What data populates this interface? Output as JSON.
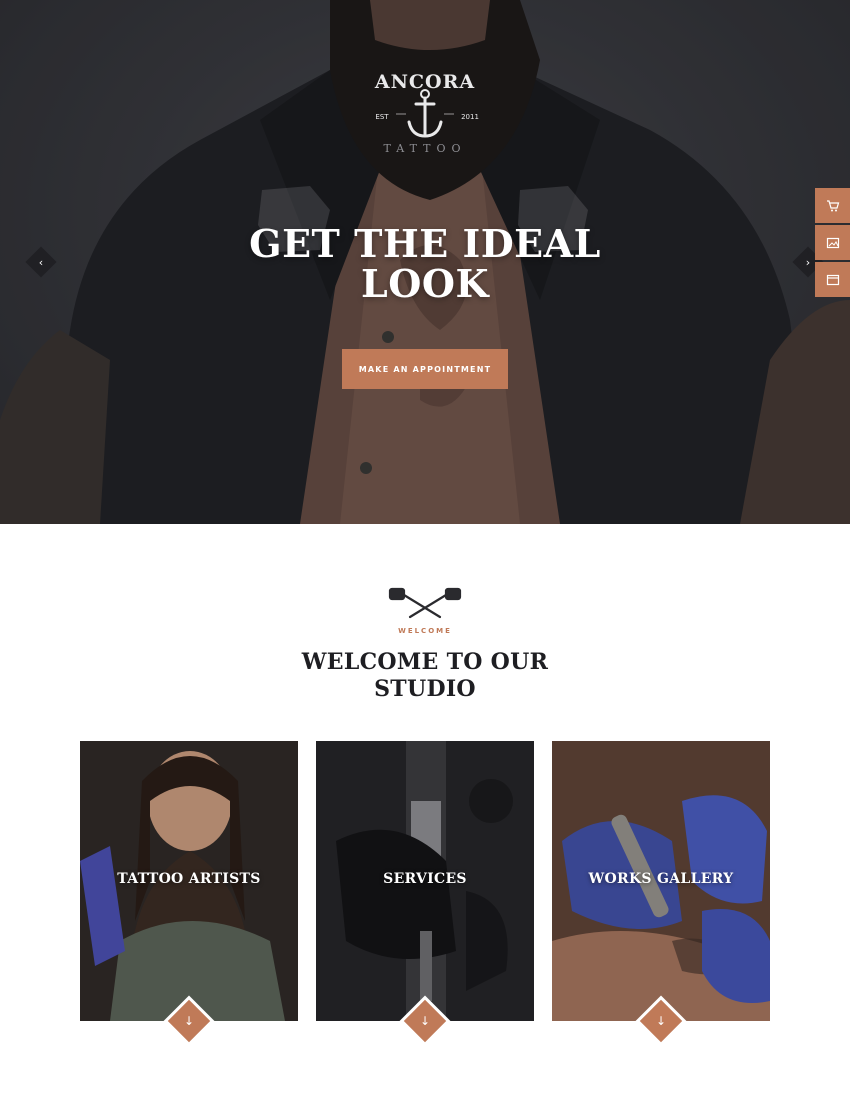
{
  "colors": {
    "accent": "#c07a58",
    "hero_dark": "#2c2d31",
    "title_dark": "#1e1e22",
    "white": "#ffffff"
  },
  "hero": {
    "logo": {
      "brand": "ANCORA",
      "est": "EST",
      "year": "2011",
      "sub": "TATTOO"
    },
    "title": "GET THE IDEAL LOOK",
    "cta_label": "MAKE AN APPOINTMENT",
    "prev_arrow": "‹",
    "next_arrow": "›"
  },
  "side_tools": [
    {
      "icon": "cart-icon"
    },
    {
      "icon": "image-icon"
    },
    {
      "icon": "window-icon"
    }
  ],
  "welcome": {
    "kicker": "WELCOME",
    "title": "WELCOME TO OUR STUDIO",
    "cards": [
      {
        "label": "TATTOO ARTISTS",
        "arrow": "↓"
      },
      {
        "label": "SERVICES",
        "arrow": "↓"
      },
      {
        "label": "WORKS GALLERY",
        "arrow": "↓"
      }
    ]
  }
}
